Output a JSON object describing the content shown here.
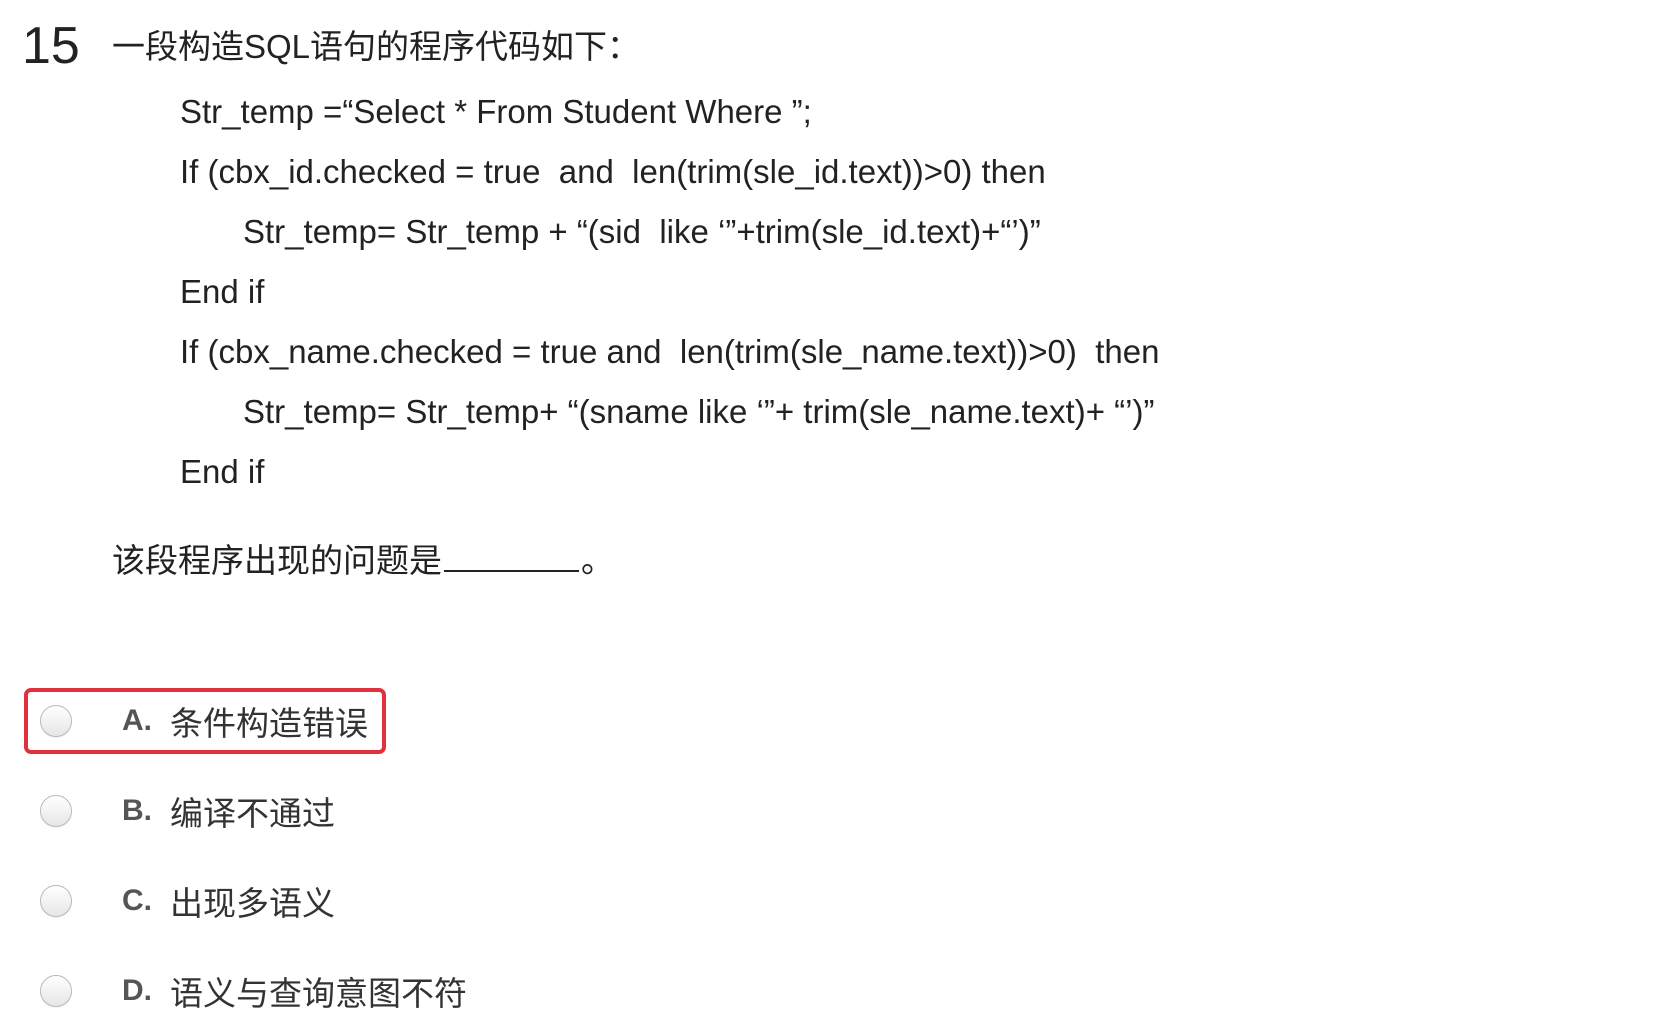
{
  "question": {
    "number": "15",
    "stem": "一段构造SQL语句的程序代码如下：",
    "code_lines": [
      "Str_temp =“Select * From Student Where ”;",
      "If (cbx_id.checked = true  and  len(trim(sle_id.text))>0) then",
      "Str_temp= Str_temp + “(sid  like ‘”+trim(sle_id.text)+“’)”",
      "End if",
      "If (cbx_name.checked = true and  len(trim(sle_name.text))>0)  then",
      "Str_temp= Str_temp+ “(sname like ‘”+ trim(sle_name.text)+ “’)”",
      "End if"
    ],
    "prompt": "该段程序出现的问题是",
    "prompt_tail": "。"
  },
  "options": [
    {
      "letter": "A.",
      "text": "条件构造错误"
    },
    {
      "letter": "B.",
      "text": "编译不通过"
    },
    {
      "letter": "C.",
      "text": "出现多语义"
    },
    {
      "letter": "D.",
      "text": "语义与查询意图不符"
    }
  ],
  "colors": {
    "highlight_border": "#e0313f",
    "text": "#222222",
    "option_letter": "#555555"
  }
}
